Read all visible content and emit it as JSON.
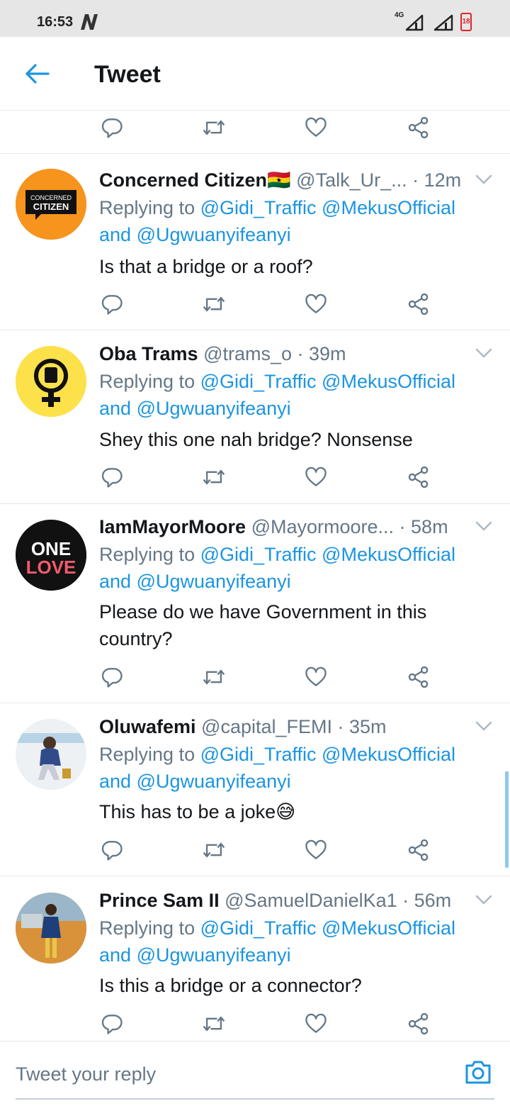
{
  "status_bar": {
    "time": "16:53",
    "network": "4G",
    "battery": "18"
  },
  "header": {
    "title": "Tweet"
  },
  "tweets": [
    {
      "name": "Concerned Citizen🇬🇭",
      "handle": "@Talk_Ur_...",
      "time": " · 12m",
      "replying_to_prefix": "Replying to ",
      "mentions_1": "@Gidi_Traffic @MekusOfficial",
      "and_word": "and ",
      "mentions_2": "@Ugwuanyifeanyi",
      "text": "Is that a bridge or a roof?",
      "avatar_text": [
        "CONCERNED",
        "CITIZEN"
      ]
    },
    {
      "name": "Oba Trams",
      "handle": "@trams_o",
      "time": " · 39m",
      "replying_to_prefix": "Replying to ",
      "mentions_1": "@Gidi_Traffic @MekusOfficial",
      "and_word": "and ",
      "mentions_2": "@Ugwuanyifeanyi",
      "text": "Shey this one nah bridge? Nonsense"
    },
    {
      "name": "IamMayorMoore",
      "handle": "@Mayormoore...",
      "time": " · 58m",
      "replying_to_prefix": "Replying to ",
      "mentions_1": "@Gidi_Traffic @MekusOfficial",
      "and_word": "and ",
      "mentions_2": "@Ugwuanyifeanyi",
      "text": "Please do we have Government in this country?",
      "avatar_text": [
        "ONE",
        "LOVE"
      ]
    },
    {
      "name": "Oluwafemi",
      "handle": "@capital_FEMI",
      "time": " · 35m",
      "replying_to_prefix": "Replying to ",
      "mentions_1": "@Gidi_Traffic @MekusOfficial",
      "and_word": "and ",
      "mentions_2": "@Ugwuanyifeanyi",
      "text": "This has to be a joke😅"
    },
    {
      "name": "Prince Sam II",
      "handle": "@SamuelDanielKa1",
      "time": " · 56m",
      "replying_to_prefix": "Replying to ",
      "mentions_1": "@Gidi_Traffic @MekusOfficial",
      "and_word": "and ",
      "mentions_2": "@Ugwuanyifeanyi",
      "text": "Is this a bridge or a connector?"
    }
  ],
  "reply_bar": {
    "placeholder": "Tweet your reply"
  },
  "icons": {
    "back": "arrow-left-icon",
    "reply": "comment-icon",
    "retweet": "retweet-icon",
    "like": "heart-icon",
    "share": "share-icon",
    "more": "chevron-down-icon",
    "camera": "camera-icon"
  },
  "colors": {
    "accent": "#1b95e0",
    "secondary_text": "#657786",
    "primary_text": "#14171a"
  }
}
